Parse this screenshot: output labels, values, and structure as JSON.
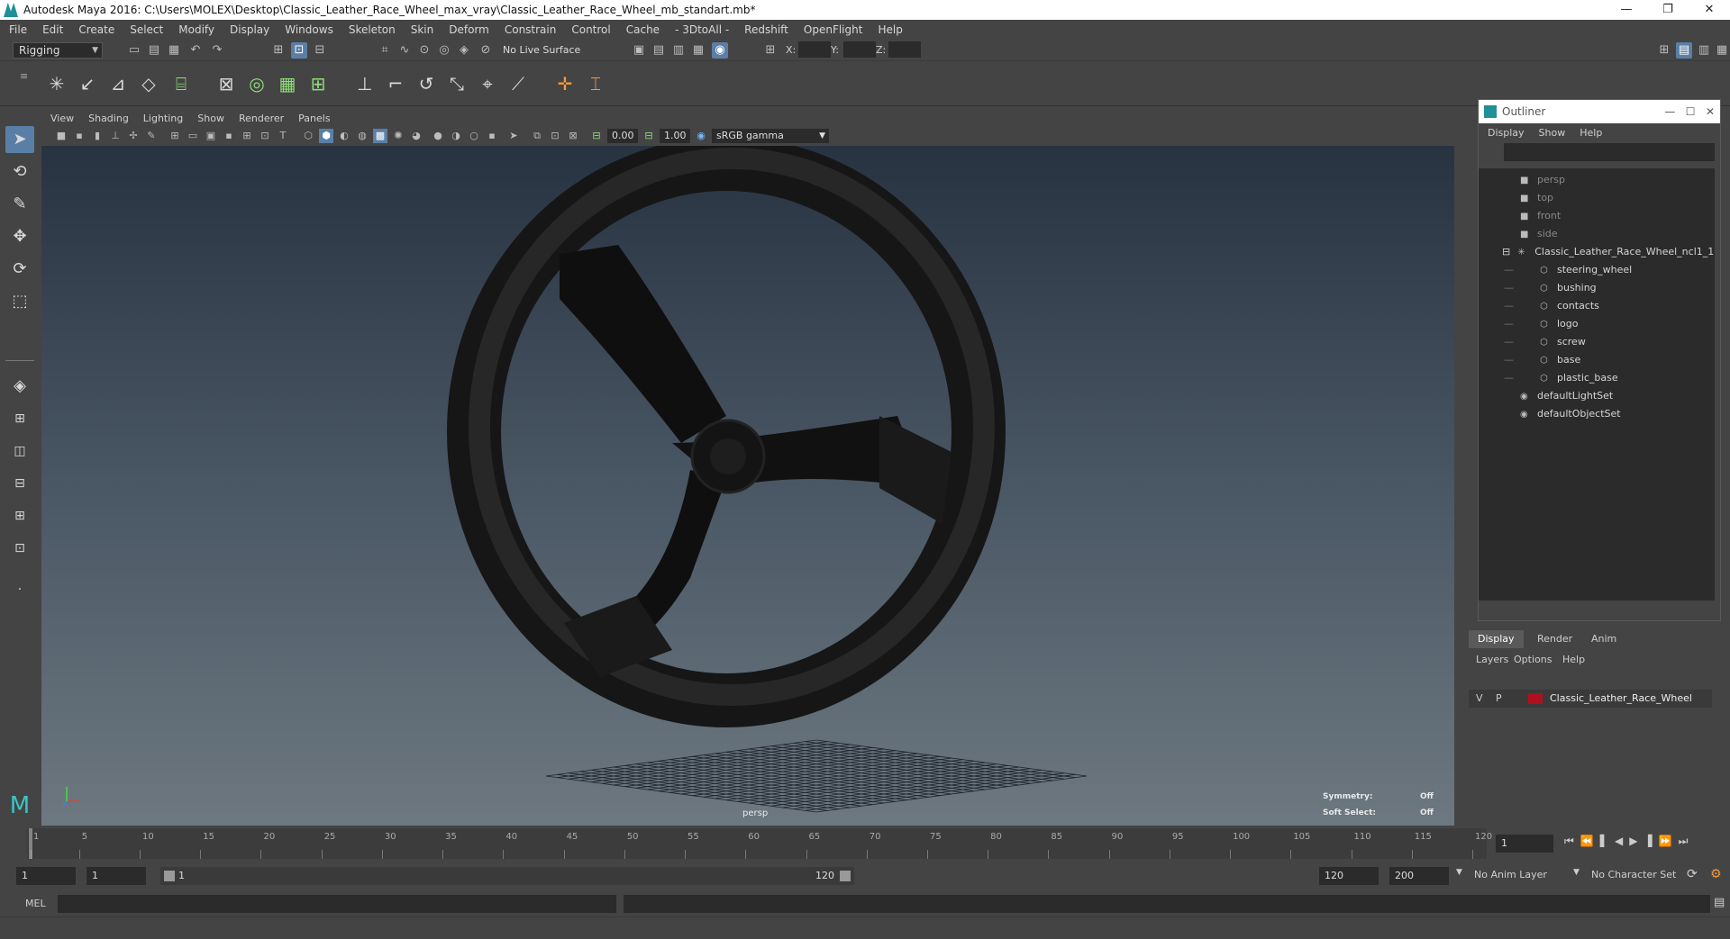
{
  "window": {
    "title": "Autodesk Maya 2016: C:\\Users\\MOLEX\\Desktop\\Classic_Leather_Race_Wheel_max_vray\\Classic_Leather_Race_Wheel_mb_standart.mb*",
    "controls": [
      "—",
      "❐",
      "✕"
    ]
  },
  "menubar": [
    "File",
    "Edit",
    "Create",
    "Select",
    "Modify",
    "Display",
    "Windows",
    "Skeleton",
    "Skin",
    "Deform",
    "Constrain",
    "Control",
    "Cache",
    "- 3DtoAll -",
    "Redshift",
    "OpenFlight",
    "Help"
  ],
  "statusline": {
    "menuset": "Rigging",
    "live_surface": "No Live Surface",
    "x_label": "X:",
    "y_label": "Y:",
    "z_label": "Z:"
  },
  "panel": {
    "menus": [
      "View",
      "Shading",
      "Lighting",
      "Show",
      "Renderer",
      "Panels"
    ],
    "exposure": "0.00",
    "gamma": "1.00",
    "colorspace": "sRGB gamma",
    "camera_label": "persp",
    "hud": {
      "symmetry_label": "Symmetry:",
      "symmetry_value": "Off",
      "soft_select_label": "Soft Select:",
      "soft_select_value": "Off"
    }
  },
  "outliner": {
    "title": "Outliner",
    "menus": [
      "Display",
      "Show",
      "Help"
    ],
    "items": [
      {
        "label": "persp",
        "icon": "camera-icon",
        "dim": true,
        "indent": 0
      },
      {
        "label": "top",
        "icon": "camera-icon",
        "dim": true,
        "indent": 0
      },
      {
        "label": "front",
        "icon": "camera-icon",
        "dim": true,
        "indent": 0
      },
      {
        "label": "side",
        "icon": "camera-icon",
        "dim": true,
        "indent": 0
      },
      {
        "label": "Classic_Leather_Race_Wheel_ncl1_1",
        "icon": "joint-icon",
        "dim": false,
        "indent": 0
      },
      {
        "label": "steering_wheel",
        "icon": "mesh-icon",
        "dim": false,
        "indent": 1
      },
      {
        "label": "bushing",
        "icon": "mesh-icon",
        "dim": false,
        "indent": 1
      },
      {
        "label": "contacts",
        "icon": "mesh-icon",
        "dim": false,
        "indent": 1
      },
      {
        "label": "logo",
        "icon": "mesh-icon",
        "dim": false,
        "indent": 1
      },
      {
        "label": "screw",
        "icon": "mesh-icon",
        "dim": false,
        "indent": 1
      },
      {
        "label": "base",
        "icon": "mesh-icon",
        "dim": false,
        "indent": 1
      },
      {
        "label": "plastic_base",
        "icon": "mesh-icon",
        "dim": false,
        "indent": 1
      },
      {
        "label": "defaultLightSet",
        "icon": "set-icon",
        "dim": false,
        "indent": 0
      },
      {
        "label": "defaultObjectSet",
        "icon": "set-icon",
        "dim": false,
        "indent": 0
      }
    ]
  },
  "layer_editor": {
    "tabs": [
      "Display",
      "Render",
      "Anim"
    ],
    "menus": [
      "Layers",
      "Options",
      "Help"
    ],
    "layer": {
      "v": "V",
      "p": "P",
      "name": "Classic_Leather_Race_Wheel",
      "color": "#b0101e"
    }
  },
  "timeline": {
    "ticks": [
      "1",
      "5",
      "10",
      "15",
      "20",
      "25",
      "30",
      "35",
      "40",
      "45",
      "50",
      "55",
      "60",
      "65",
      "70",
      "75",
      "80",
      "85",
      "90",
      "95",
      "100",
      "105",
      "110",
      "115",
      "120"
    ],
    "current_frame": "1"
  },
  "range": {
    "start": "1",
    "playback_start": "1",
    "slider_start": "1",
    "slider_end": "120",
    "playback_end": "120",
    "end": "200",
    "anim_layer": "No Anim Layer",
    "character_set": "No Character Set"
  },
  "cmdline": {
    "label": "MEL"
  },
  "colors": {
    "accent": "#5a7fa6",
    "maya_teal": "#1f8f9a",
    "layer_red": "#b0101e"
  }
}
